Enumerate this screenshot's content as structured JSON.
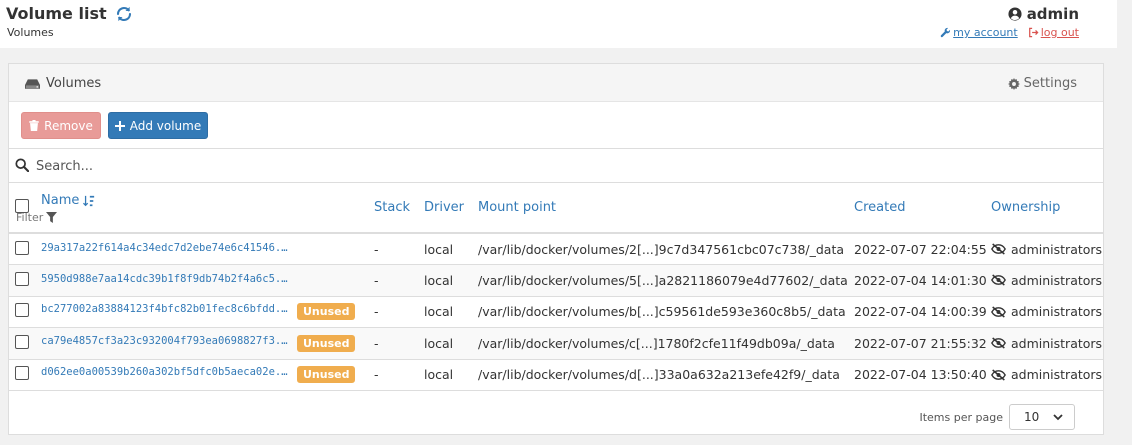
{
  "header": {
    "title": "Volume list",
    "subtitle": "Volumes",
    "username": "admin",
    "my_account": "my account",
    "log_out": "log out"
  },
  "panel": {
    "title": "Volumes",
    "settings": "Settings",
    "remove_label": "Remove",
    "add_label": "Add volume",
    "search_placeholder": "Search..."
  },
  "table": {
    "columns": {
      "name": "Name",
      "filter": "Filter",
      "stack": "Stack",
      "driver": "Driver",
      "mount": "Mount point",
      "created": "Created",
      "ownership": "Ownership"
    },
    "rows": [
      {
        "name": "29a317a22f614a4c34edc7d2ebe74e6c41546...",
        "unused": "",
        "stack": "-",
        "driver": "local",
        "mount": "/var/lib/docker/volumes/2[...]9c7d347561cbc07c738/_data",
        "created": "2022-07-07 22:04:55",
        "ownership": "administrators"
      },
      {
        "name": "5950d988e7aa14cdc39b1f8f9db74b2f4a6c5...",
        "unused": "",
        "stack": "-",
        "driver": "local",
        "mount": "/var/lib/docker/volumes/5[...]a2821186079e4d77602/_data",
        "created": "2022-07-04 14:01:30",
        "ownership": "administrators"
      },
      {
        "name": "bc277002a83884123f4bfc82b01fec8c6bfdd...",
        "unused": "Unused",
        "stack": "-",
        "driver": "local",
        "mount": "/var/lib/docker/volumes/b[...]c59561de593e360c8b5/_data",
        "created": "2022-07-04 14:00:39",
        "ownership": "administrators"
      },
      {
        "name": "ca79e4857cf3a23c932004f793ea0698827f3...",
        "unused": "Unused",
        "stack": "-",
        "driver": "local",
        "mount": "/var/lib/docker/volumes/c[...]1780f2cfe11f49db09a/_data",
        "created": "2022-07-07 21:55:32",
        "ownership": "administrators"
      },
      {
        "name": "d062ee0a00539b260a302bf5dfc0b5aeca02e...",
        "unused": "Unused",
        "stack": "-",
        "driver": "local",
        "mount": "/var/lib/docker/volumes/d[...]33a0a632a213efe42f9/_data",
        "created": "2022-07-04 13:50:40",
        "ownership": "administrators"
      }
    ]
  },
  "footer": {
    "items_per_page_label": "Items per page",
    "items_per_page_value": "10"
  },
  "colors": {
    "accent": "#337ab7",
    "danger": "#d9534f",
    "warning": "#f0ad4e"
  }
}
